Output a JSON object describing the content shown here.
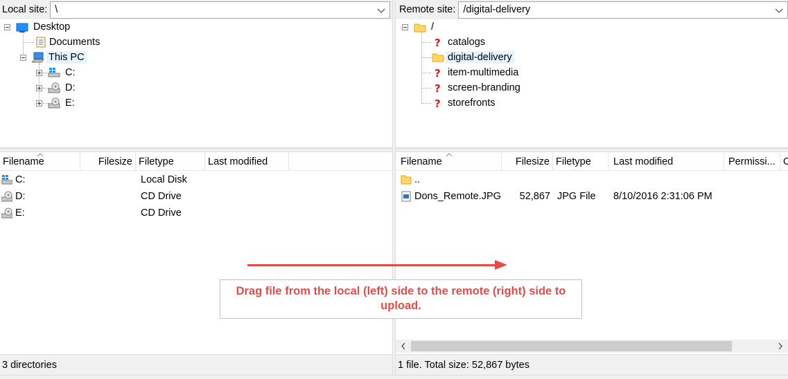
{
  "local": {
    "site_label": "Local site:",
    "site_path": "\\",
    "tree": [
      {
        "label": "Desktop",
        "icon": "desktop-icon"
      },
      {
        "label": "Documents",
        "icon": "documents-icon"
      },
      {
        "label": "This PC",
        "icon": "computer-icon"
      },
      {
        "label": "C:",
        "icon": "windows-drive-icon"
      },
      {
        "label": "D:",
        "icon": "cd-drive-icon"
      },
      {
        "label": "E:",
        "icon": "cd-drive-icon"
      }
    ],
    "columns": [
      "Filename",
      "Filesize",
      "Filetype",
      "Last modified"
    ],
    "rows": [
      {
        "name": "C:",
        "type": "Local Disk",
        "icon": "windows-drive-icon"
      },
      {
        "name": "D:",
        "type": "CD Drive",
        "icon": "cd-drive-icon"
      },
      {
        "name": "E:",
        "type": "CD Drive",
        "icon": "cd-drive-icon"
      }
    ],
    "status": "3 directories"
  },
  "remote": {
    "site_label": "Remote site:",
    "site_path": "/digital-delivery",
    "tree_root": "/",
    "tree": [
      {
        "label": "catalogs",
        "icon": "unknown-folder-icon"
      },
      {
        "label": "digital-delivery",
        "icon": "folder-icon"
      },
      {
        "label": "item-multimedia",
        "icon": "unknown-folder-icon"
      },
      {
        "label": "screen-branding",
        "icon": "unknown-folder-icon"
      },
      {
        "label": "storefronts",
        "icon": "unknown-folder-icon"
      }
    ],
    "columns": [
      "Filename",
      "Filesize",
      "Filetype",
      "Last modified",
      "Permissi...",
      "O"
    ],
    "parent_dir": "..",
    "files": [
      {
        "name": "Dons_Remote.JPG",
        "size": "52,867",
        "type": "JPG File",
        "modified": "8/10/2016 2:31:06 PM",
        "icon": "image-file-icon"
      }
    ],
    "status": "1 file. Total size: 52,867 bytes"
  },
  "annotation": {
    "text": "Drag file from the local (left) side to the remote (right) side to upload.",
    "color": "#e04b4b"
  }
}
